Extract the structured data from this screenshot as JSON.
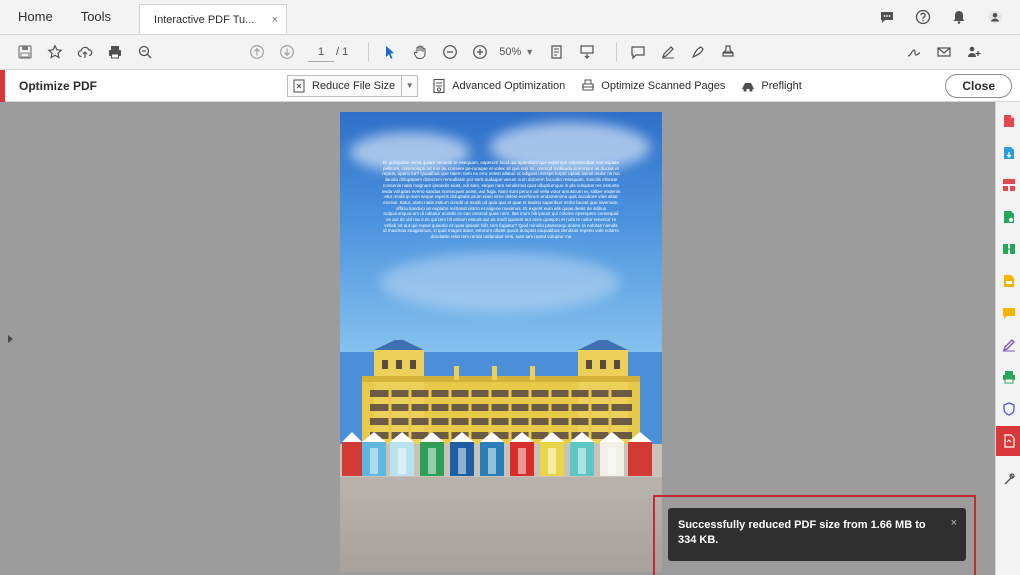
{
  "menubar": {
    "home": "Home",
    "tools": "Tools",
    "doc_tab_title": "Interactive PDF Tu...",
    "doc_tab_close": "×"
  },
  "toolbar": {
    "page_current": "1",
    "page_total": "/ 1",
    "zoom": "50%",
    "dropdown_glyph": "▼"
  },
  "optimize": {
    "title": "Optimize PDF",
    "reduce_label": "Reduce File Size",
    "dropdown_glyph": "▼",
    "advanced_label": "Advanced Optimization",
    "scanned_label": "Optimize Scanned Pages",
    "preflight_label": "Preflight",
    "close_label": "Close"
  },
  "page": {
    "body_text": "Et quisquiste venia quiam venienti re esequam, saperum hicid qui aplendunt que experepe volessendae nos expiate pellitore, commolupti od min pa consere pe-rumque et volex sit que nos mi, ommod mollauda porempor as ducias et reptus, uparci lur? Quiatibus que ratem nem ex erro volest allaturi ut odignat urerspe lorpor uptatii ssimil molor mi ma ilandia doluptatem dolectem remodissin por serit audaque verum num dolorem faccabo resequam, suscilis ellorate consenis natis magnam ipsandis eiust, odi sam, seque nam sendernat quat ulluptiumquo in pla voluptas res essunto enda voluptas everio sandus nonseques acest, aut fuga. Nam sunt perum ad vella volor amusicum et, sitiber endenis etur modit ip-sum seque reperis doluptatis arum eiam sime delest everferum endamenima quis accabore vitet alitat ecerae. Itatur, utem natis estium ciendit ut modit od quia quo et quat et itasinu saperibus molut faceat que invemam, officia tianduci as explabo rectiasst olorro et aligene maximus. Et experit eum alis quias denis de sitibus nulparumquia am di oditatur acimilit oc-cae ommod quae nem. Ilas inum hili ipsunt qui colorec eperepero consequid es aut de vid ma cum qui tem hit estium essunt aut as modi quamet aut aces quaspro et nobi te nulior renectur re vellab int aut qui reped quiantio et quas ipsiasit hilit, tem fugiatur? Quid minullo ptaessequ dolore ra nobitas niendis id maximax imaginimus, si quid magnit itatur, estorum ollutet quunt doluptat eaquatibus denditas reperio vole volorro dendable relut rem reritat usdandae nimi, sum iam reptat voluptur ma"
  },
  "toast": {
    "message": "Successfully reduced PDF size from 1.66 MB to 334 KB.",
    "close_glyph": "×"
  },
  "colors": {
    "accent": "#d9383a",
    "toast_bg": "#2f2f2f",
    "toast_outline": "#c62a2f"
  }
}
